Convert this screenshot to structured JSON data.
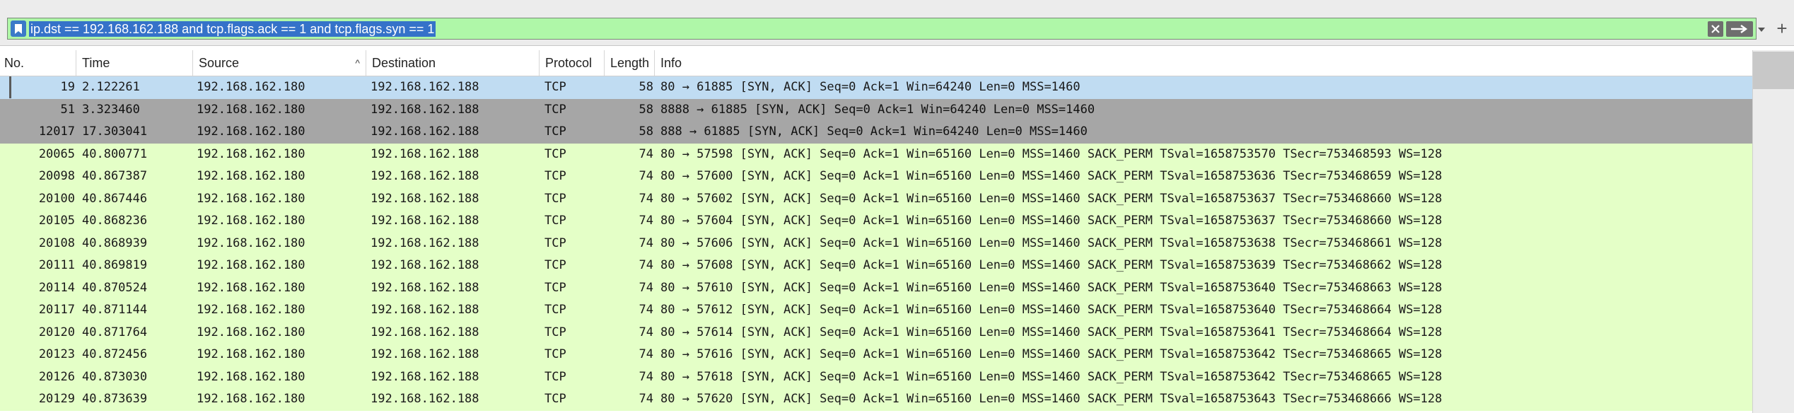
{
  "filter": {
    "expression": "ip.dst == 192.168.162.188 and tcp.flags.ack == 1 and tcp.flags.syn == 1",
    "add_label": "+"
  },
  "columns": [
    {
      "label": "No."
    },
    {
      "label": "Time"
    },
    {
      "label": "Source"
    },
    {
      "label": "Destination"
    },
    {
      "label": "Protocol"
    },
    {
      "label": "Length"
    },
    {
      "label": "Info"
    }
  ],
  "colors": {
    "selected_row": "#c0dcf2",
    "gray_row": "#a6a6a6",
    "green_row": "#e4ffc7",
    "filter_bg": "#aff7a8",
    "filter_highlight": "#3572c9"
  },
  "packets": [
    {
      "no": "19",
      "time": "2.122261",
      "src": "192.168.162.180",
      "dst": "192.168.162.188",
      "proto": "TCP",
      "len": "58",
      "info": "80 → 61885 [SYN, ACK] Seq=0 Ack=1 Win=64240 Len=0 MSS=1460",
      "style": "selected"
    },
    {
      "no": "51",
      "time": "3.323460",
      "src": "192.168.162.180",
      "dst": "192.168.162.188",
      "proto": "TCP",
      "len": "58",
      "info": "8888 → 61885 [SYN, ACK] Seq=0 Ack=1 Win=64240 Len=0 MSS=1460",
      "style": "gray"
    },
    {
      "no": "12017",
      "time": "17.303041",
      "src": "192.168.162.180",
      "dst": "192.168.162.188",
      "proto": "TCP",
      "len": "58",
      "info": "888 → 61885 [SYN, ACK] Seq=0 Ack=1 Win=64240 Len=0 MSS=1460",
      "style": "gray"
    },
    {
      "no": "20065",
      "time": "40.800771",
      "src": "192.168.162.180",
      "dst": "192.168.162.188",
      "proto": "TCP",
      "len": "74",
      "info": "80 → 57598 [SYN, ACK] Seq=0 Ack=1 Win=65160 Len=0 MSS=1460 SACK_PERM TSval=1658753570 TSecr=753468593 WS=128",
      "style": "green"
    },
    {
      "no": "20098",
      "time": "40.867387",
      "src": "192.168.162.180",
      "dst": "192.168.162.188",
      "proto": "TCP",
      "len": "74",
      "info": "80 → 57600 [SYN, ACK] Seq=0 Ack=1 Win=65160 Len=0 MSS=1460 SACK_PERM TSval=1658753636 TSecr=753468659 WS=128",
      "style": "green"
    },
    {
      "no": "20100",
      "time": "40.867446",
      "src": "192.168.162.180",
      "dst": "192.168.162.188",
      "proto": "TCP",
      "len": "74",
      "info": "80 → 57602 [SYN, ACK] Seq=0 Ack=1 Win=65160 Len=0 MSS=1460 SACK_PERM TSval=1658753637 TSecr=753468660 WS=128",
      "style": "green"
    },
    {
      "no": "20105",
      "time": "40.868236",
      "src": "192.168.162.180",
      "dst": "192.168.162.188",
      "proto": "TCP",
      "len": "74",
      "info": "80 → 57604 [SYN, ACK] Seq=0 Ack=1 Win=65160 Len=0 MSS=1460 SACK_PERM TSval=1658753637 TSecr=753468660 WS=128",
      "style": "green"
    },
    {
      "no": "20108",
      "time": "40.868939",
      "src": "192.168.162.180",
      "dst": "192.168.162.188",
      "proto": "TCP",
      "len": "74",
      "info": "80 → 57606 [SYN, ACK] Seq=0 Ack=1 Win=65160 Len=0 MSS=1460 SACK_PERM TSval=1658753638 TSecr=753468661 WS=128",
      "style": "green"
    },
    {
      "no": "20111",
      "time": "40.869819",
      "src": "192.168.162.180",
      "dst": "192.168.162.188",
      "proto": "TCP",
      "len": "74",
      "info": "80 → 57608 [SYN, ACK] Seq=0 Ack=1 Win=65160 Len=0 MSS=1460 SACK_PERM TSval=1658753639 TSecr=753468662 WS=128",
      "style": "green"
    },
    {
      "no": "20114",
      "time": "40.870524",
      "src": "192.168.162.180",
      "dst": "192.168.162.188",
      "proto": "TCP",
      "len": "74",
      "info": "80 → 57610 [SYN, ACK] Seq=0 Ack=1 Win=65160 Len=0 MSS=1460 SACK_PERM TSval=1658753640 TSecr=753468663 WS=128",
      "style": "green"
    },
    {
      "no": "20117",
      "time": "40.871144",
      "src": "192.168.162.180",
      "dst": "192.168.162.188",
      "proto": "TCP",
      "len": "74",
      "info": "80 → 57612 [SYN, ACK] Seq=0 Ack=1 Win=65160 Len=0 MSS=1460 SACK_PERM TSval=1658753640 TSecr=753468664 WS=128",
      "style": "green"
    },
    {
      "no": "20120",
      "time": "40.871764",
      "src": "192.168.162.180",
      "dst": "192.168.162.188",
      "proto": "TCP",
      "len": "74",
      "info": "80 → 57614 [SYN, ACK] Seq=0 Ack=1 Win=65160 Len=0 MSS=1460 SACK_PERM TSval=1658753641 TSecr=753468664 WS=128",
      "style": "green"
    },
    {
      "no": "20123",
      "time": "40.872456",
      "src": "192.168.162.180",
      "dst": "192.168.162.188",
      "proto": "TCP",
      "len": "74",
      "info": "80 → 57616 [SYN, ACK] Seq=0 Ack=1 Win=65160 Len=0 MSS=1460 SACK_PERM TSval=1658753642 TSecr=753468665 WS=128",
      "style": "green"
    },
    {
      "no": "20126",
      "time": "40.873030",
      "src": "192.168.162.180",
      "dst": "192.168.162.188",
      "proto": "TCP",
      "len": "74",
      "info": "80 → 57618 [SYN, ACK] Seq=0 Ack=1 Win=65160 Len=0 MSS=1460 SACK_PERM TSval=1658753642 TSecr=753468665 WS=128",
      "style": "green"
    },
    {
      "no": "20129",
      "time": "40.873639",
      "src": "192.168.162.180",
      "dst": "192.168.162.188",
      "proto": "TCP",
      "len": "74",
      "info": "80 → 57620 [SYN, ACK] Seq=0 Ack=1 Win=65160 Len=0 MSS=1460 SACK_PERM TSval=1658753643 TSecr=753468666 WS=128",
      "style": "green"
    }
  ]
}
